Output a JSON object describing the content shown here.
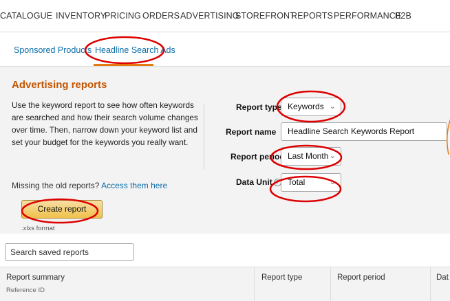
{
  "topnav": {
    "items": [
      "CATALOGUE",
      "INVENTORY",
      "PRICING",
      "ORDERS",
      "ADVERTISING",
      "STOREFRONT",
      "REPORTS",
      "PERFORMANCE",
      "B2B"
    ]
  },
  "tabs": {
    "items": [
      "Sponsored Products",
      "Headline Search Ads"
    ],
    "active": "Headline Search Ads"
  },
  "panel": {
    "title": "Advertising reports",
    "description_lines": [
      "Use the keyword report to see how often keywords",
      "are searched and how their search volume changes",
      "over time. Then, narrow down your keyword list and",
      "set your budget for the keywords you really want."
    ],
    "missing_text": "Missing the old reports? ",
    "missing_link": "Access them here",
    "create_button": "Create report",
    "format_note": ".xlxs format"
  },
  "form": {
    "report_type_label": "Report type",
    "report_type_value": "Keywords",
    "report_name_label": "Report name",
    "report_name_value": "Headline Search Keywords Report",
    "report_period_label": "Report period",
    "report_period_value": "Last Month",
    "data_unit_label": "Data Unit",
    "data_unit_value": "Total"
  },
  "search": {
    "placeholder": "Search saved reports"
  },
  "table": {
    "columns": [
      "Report summary",
      "Report type",
      "Report period",
      "Dat"
    ],
    "subheader": "Reference ID"
  },
  "colors": {
    "annotation": "#dd0000",
    "title_orange": "#c45500",
    "link_blue": "#0b6ea8",
    "tab_underline": "#e47911"
  }
}
